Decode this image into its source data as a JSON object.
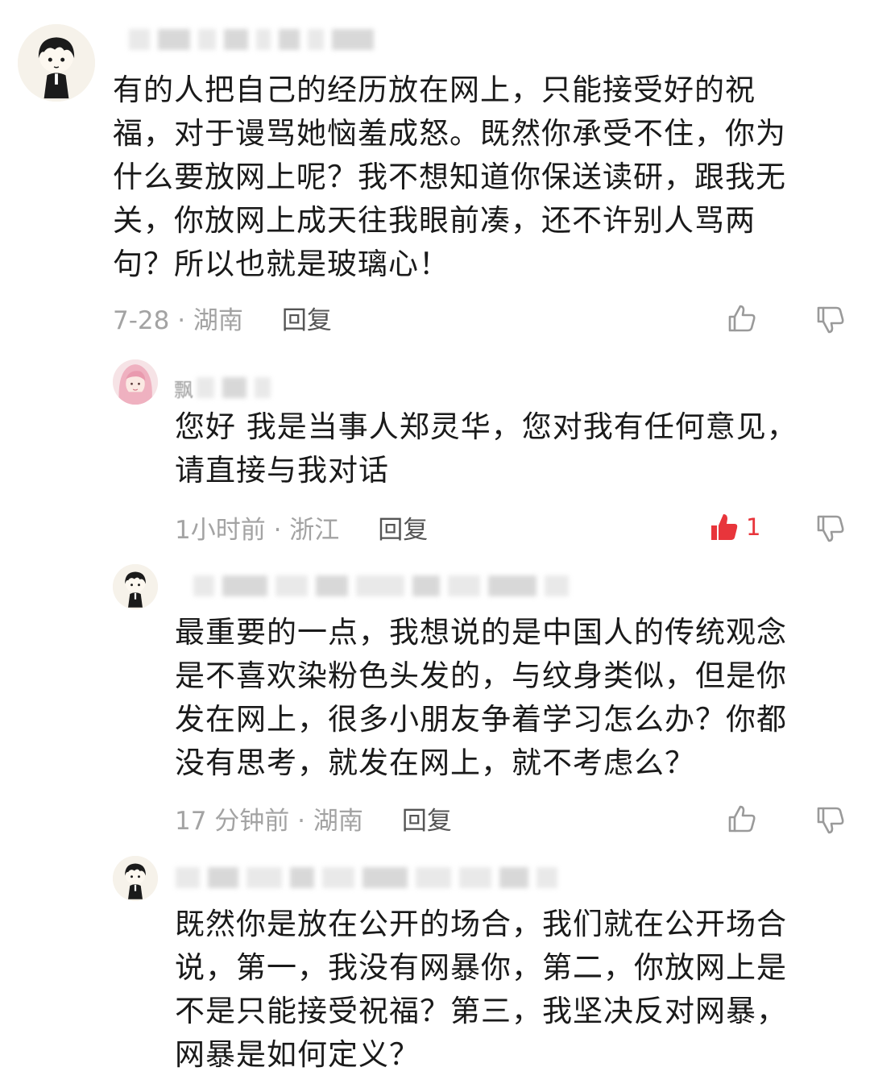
{
  "comments": [
    {
      "text": "有的人把自己的经历放在网上，只能接受好的祝\n福，对于谩骂她恼羞成怒。既然你承受不住，你为\n什么要放网上呢？我不想知道你保送读研，跟我无\n关，你放网上成天往我眼前凑，还不许别人骂两\n句？所以也就是玻璃心！",
      "meta": "7-28 · 湖南",
      "reply_label": "回复",
      "liked": false,
      "like_count": ""
    },
    {
      "author_visible": "飘",
      "text": "您好 我是当事人郑灵华，您对我有任何意见，\n请直接与我对话",
      "meta": "1小时前 · 浙江",
      "reply_label": "回复",
      "liked": true,
      "like_count": "1"
    },
    {
      "text": "最重要的一点，我想说的是中国人的传统观念\n是不喜欢染粉色头发的，与纹身类似，但是你\n发在网上，很多小朋友争着学习怎么办？你都\n没有思考，就发在网上，就不考虑么？",
      "meta": "17 分钟前 · 湖南",
      "reply_label": "回复",
      "liked": false,
      "like_count": ""
    },
    {
      "text": "既然你是放在公开的场合，我们就在公开场合\n说，第一，我没有网暴你，第二，你放网上是\n不是只能接受祝福？第三，我坚决反对网暴，\n网暴是如何定义？"
    }
  ],
  "colors": {
    "text": "#1a1a1a",
    "meta": "#a3a3a3",
    "reply": "#555555",
    "like_active": "#e8353b",
    "icon": "#9a9a9a"
  },
  "icons": {
    "like": "thumbs-up-icon",
    "dislike": "thumbs-down-icon"
  }
}
